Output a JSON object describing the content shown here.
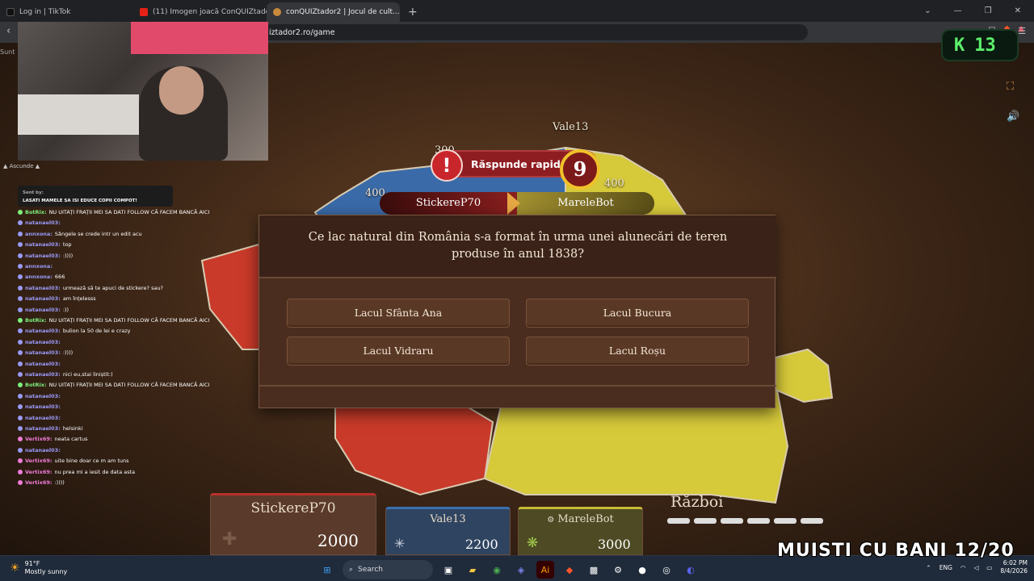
{
  "browser": {
    "tabs": [
      {
        "title": "Log in | TikTok",
        "active": false
      },
      {
        "title": "(11) Imogen joacă ConQUIZtador (m...",
        "active": false
      },
      {
        "title": "conQUIZtador2 | Jocul de cult...",
        "active": true
      }
    ],
    "url": "iztador2.ro/game"
  },
  "stream": {
    "sunt_label": "Sunt",
    "ascunde_label": "▲ Ascunde ▲",
    "pinned": {
      "sender": "Sent by:",
      "text": "LASATI MAMELE SA ISI EDUCE COPII COMPOT!"
    },
    "chat": [
      {
        "user": "BotRix:",
        "msg": "NU UITAȚI FRAȚII MEI SA DATI FOLLOW CĂ FACEM BANCĂ AICI",
        "color": "#7cf07c"
      },
      {
        "user": "natanael03:",
        "msg": "",
        "color": "#9a9afa"
      },
      {
        "user": "annxona:",
        "msg": "Sângele se crede intr un edit acu",
        "color": "#9a9afa"
      },
      {
        "user": "natanael03:",
        "msg": "top",
        "color": "#9a9afa"
      },
      {
        "user": "natanael03:",
        "msg": ":))))",
        "color": "#9a9afa"
      },
      {
        "user": "annxona:",
        "msg": "",
        "color": "#9a9afa"
      },
      {
        "user": "annxona:",
        "msg": "666",
        "color": "#9a9afa"
      },
      {
        "user": "natanael03:",
        "msg": "urmează să te apuci de stickere? sau?",
        "color": "#9a9afa"
      },
      {
        "user": "natanael03:",
        "msg": "am înțelesss",
        "color": "#9a9afa"
      },
      {
        "user": "natanael03:",
        "msg": ":))",
        "color": "#9a9afa"
      },
      {
        "user": "BotRix:",
        "msg": "NU UITAȚI FRAȚII MEI SA DATI FOLLOW CĂ FACEM BANCĂ AICI",
        "color": "#7cf07c"
      },
      {
        "user": "natanael03:",
        "msg": "bulion la 50 de lei e crazy",
        "color": "#9a9afa"
      },
      {
        "user": "natanael03:",
        "msg": "",
        "color": "#9a9afa"
      },
      {
        "user": "natanael03:",
        "msg": ":))))",
        "color": "#9a9afa"
      },
      {
        "user": "natanael03:",
        "msg": "",
        "color": "#9a9afa"
      },
      {
        "user": "natanael03:",
        "msg": "nici eu,stai liniștit:)",
        "color": "#9a9afa"
      },
      {
        "user": "BotRix:",
        "msg": "NU UITAȚI FRAȚII MEI SA DATI FOLLOW CĂ FACEM BANCĂ AICI",
        "color": "#7cf07c"
      },
      {
        "user": "natanael03:",
        "msg": "",
        "color": "#9a9afa"
      },
      {
        "user": "natanael03:",
        "msg": "",
        "color": "#9a9afa"
      },
      {
        "user": "natanael03:",
        "msg": "",
        "color": "#9a9afa"
      },
      {
        "user": "natanael03:",
        "msg": "helsinki",
        "color": "#9a9afa"
      },
      {
        "user": "Vertix69:",
        "msg": "neata cartus",
        "color": "#f07cd8"
      },
      {
        "user": "natanael03:",
        "msg": "",
        "color": "#9a9afa"
      },
      {
        "user": "Vertix69:",
        "msg": "uite bine doar ce m am tuns",
        "color": "#f07cd8"
      },
      {
        "user": "Vertix69:",
        "msg": "nu prea mi a iesit de data asta",
        "color": "#f07cd8"
      },
      {
        "user": "Vertix69:",
        "msg": ":))))",
        "color": "#f07cd8"
      }
    ],
    "kick_count": "13",
    "overlay": "MUISTI CU BANI 12/20"
  },
  "map": {
    "scores": [
      "300",
      "400",
      "400"
    ],
    "vale_label": "Vale13"
  },
  "quiz": {
    "banner": "Răspunde rapid!",
    "timer": "9",
    "player_left": "StickereP70",
    "player_right": "MareleBot",
    "question": "Ce lac natural din România s-a format în urma unei alunecări de teren produse în anul 1838?",
    "answers": [
      "Lacul Sfânta Ana",
      "Lacul Bucura",
      "Lacul Vidraru",
      "Lacul Roșu"
    ]
  },
  "scoreboard": {
    "players": [
      {
        "name": "StickereP70",
        "points": "2000"
      },
      {
        "name": "Vale13",
        "points": "2200"
      },
      {
        "name": "MareleBot",
        "points": "3000"
      }
    ],
    "mode": "Război"
  },
  "taskbar": {
    "temp": "91°F",
    "weather": "Mostly sunny",
    "search": "Search",
    "lang": "ENG",
    "time": "6:02 PM",
    "date": "8/4/2026"
  }
}
